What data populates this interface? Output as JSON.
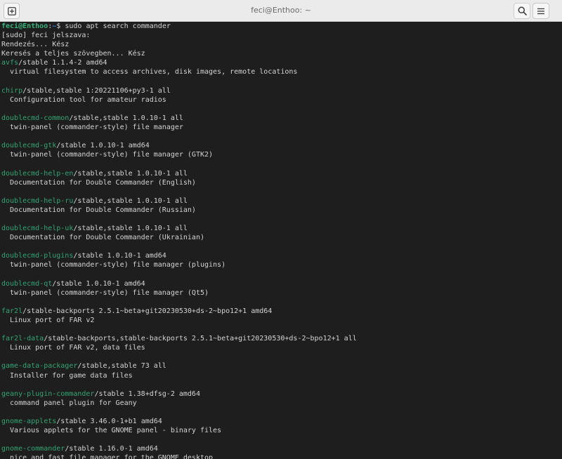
{
  "window": {
    "title": "feci@Enthoo: ~",
    "icons": {
      "new_tab": "plus-in-square-icon",
      "search": "magnifier-icon",
      "menu": "hamburger-icon"
    }
  },
  "colors": {
    "terminal_bg": "#1e1e1e",
    "text": "#d4d4d4",
    "package_name": "#33a473",
    "prompt_user": "#39b27b",
    "prompt_dir": "#3a7bd5",
    "titlebar_bg": "#ebebeb"
  },
  "terminal": {
    "prompt": {
      "user_host": "feci@Enthoo",
      "sep": ":",
      "dir": "~",
      "symbol": "$ ",
      "command": "sudo apt search commander"
    },
    "preamble": [
      "[sudo] feci jelszava:",
      "Rendezés... Kész",
      "Keresés a teljes szövegben... Kész"
    ],
    "packages": [
      {
        "name": "avfs",
        "info": "/stable 1.1.4-2 amd64",
        "desc": "  virtual filesystem to access archives, disk images, remote locations"
      },
      {
        "name": "chirp",
        "info": "/stable,stable 1:20221106+py3-1 all",
        "desc": "  Configuration tool for amateur radios"
      },
      {
        "name": "doublecmd-common",
        "info": "/stable,stable 1.0.10-1 all",
        "desc": "  twin-panel (commander-style) file manager"
      },
      {
        "name": "doublecmd-gtk",
        "info": "/stable 1.0.10-1 amd64",
        "desc": "  twin-panel (commander-style) file manager (GTK2)"
      },
      {
        "name": "doublecmd-help-en",
        "info": "/stable,stable 1.0.10-1 all",
        "desc": "  Documentation for Double Commander (English)"
      },
      {
        "name": "doublecmd-help-ru",
        "info": "/stable,stable 1.0.10-1 all",
        "desc": "  Documentation for Double Commander (Russian)"
      },
      {
        "name": "doublecmd-help-uk",
        "info": "/stable,stable 1.0.10-1 all",
        "desc": "  Documentation for Double Commander (Ukrainian)"
      },
      {
        "name": "doublecmd-plugins",
        "info": "/stable 1.0.10-1 amd64",
        "desc": "  twin-panel (commander-style) file manager (plugins)"
      },
      {
        "name": "doublecmd-qt",
        "info": "/stable 1.0.10-1 amd64",
        "desc": "  twin-panel (commander-style) file manager (Qt5)"
      },
      {
        "name": "far2l",
        "info": "/stable-backports 2.5.1~beta+git20230530+ds-2~bpo12+1 amd64",
        "desc": "  Linux port of FAR v2"
      },
      {
        "name": "far2l-data",
        "info": "/stable-backports,stable-backports 2.5.1~beta+git20230530+ds-2~bpo12+1 all",
        "desc": "  Linux port of FAR v2, data files"
      },
      {
        "name": "game-data-packager",
        "info": "/stable,stable 73 all",
        "desc": "  Installer for game data files"
      },
      {
        "name": "geany-plugin-commander",
        "info": "/stable 1.38+dfsg-2 amd64",
        "desc": "  command panel plugin for Geany"
      },
      {
        "name": "gnome-applets",
        "info": "/stable 3.46.0-1+b1 amd64",
        "desc": "  Various applets for the GNOME panel - binary files"
      },
      {
        "name": "gnome-commander",
        "info": "/stable 1.16.0-1 amd64",
        "desc": "  nice and fast file manager for the GNOME desktop"
      }
    ]
  }
}
